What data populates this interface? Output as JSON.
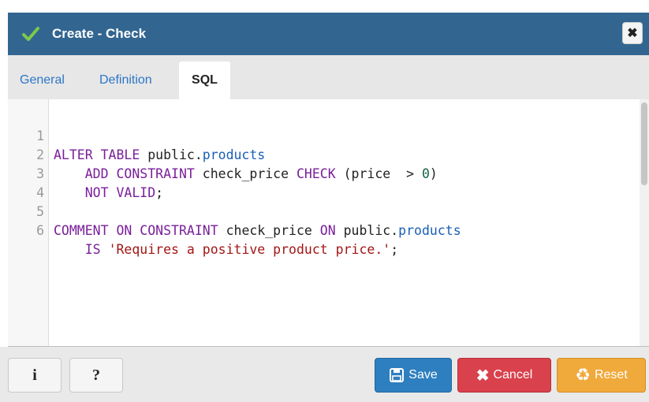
{
  "dialog": {
    "title": "Create - Check"
  },
  "tabs": [
    {
      "label": "General"
    },
    {
      "label": "Definition"
    },
    {
      "label": "SQL",
      "active": true
    }
  ],
  "editor": {
    "lines": [
      {
        "num": "1"
      },
      {
        "num": "2"
      },
      {
        "num": "3"
      },
      {
        "num": "4"
      },
      {
        "num": "5"
      },
      {
        "num": "6"
      }
    ],
    "tokens": {
      "alter": "ALTER",
      "table": "TABLE",
      "public1": "public",
      "dot1": ".",
      "products1": "products",
      "add": "ADD",
      "constraint1": "CONSTRAINT",
      "name1": "check_price",
      "check": "CHECK",
      "expr": "(price  > ",
      "zero": "0",
      "close": ")",
      "not": "NOT",
      "valid": "VALID",
      "semi1": ";",
      "comment": "COMMENT",
      "on1": "ON",
      "constraint2": "CONSTRAINT",
      "name2": "check_price",
      "on2": "ON",
      "public2": "public",
      "dot2": ".",
      "products2": "products",
      "is": "IS",
      "str": "'Requires a positive product price.'",
      "semi2": ";"
    }
  },
  "footer": {
    "info_label": "i",
    "help_label": "?",
    "save_label": "Save",
    "cancel_label": "Cancel",
    "reset_label": "Reset"
  },
  "colors": {
    "titlebar": "#326690",
    "save": "#2e7fbf",
    "cancel": "#d9414c",
    "reset": "#f0a93b"
  }
}
